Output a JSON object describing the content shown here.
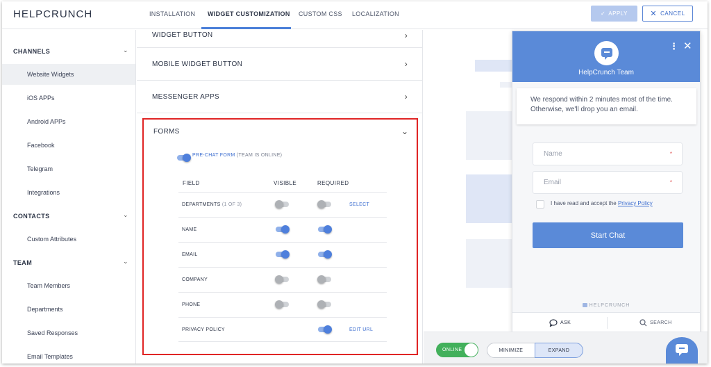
{
  "app": {
    "brand": "HELPCRUNCH"
  },
  "nav": {
    "tabs": [
      {
        "label": "INSTALLATION"
      },
      {
        "label": "WIDGET CUSTOMIZATION"
      },
      {
        "label": "CUSTOM CSS"
      },
      {
        "label": "LOCALIZATION"
      }
    ],
    "active_tab": "WIDGET CUSTOMIZATION",
    "apply_label": "APPLY",
    "cancel_label": "CANCEL"
  },
  "sidebar": {
    "sections": [
      {
        "title": "CHANNELS",
        "items": [
          "Website Widgets",
          "iOS APPs",
          "Android APPs",
          "Facebook",
          "Telegram",
          "Integrations"
        ]
      },
      {
        "title": "CONTACTS",
        "items": [
          "Custom Attributes"
        ]
      },
      {
        "title": "TEAM",
        "items": [
          "Team Members",
          "Departments",
          "Saved Responses",
          "Email Templates"
        ]
      }
    ],
    "active_item": "Website Widgets"
  },
  "settings": {
    "accordion": [
      "WIDGET BUTTON",
      "MOBILE WIDGET BUTTON",
      "MESSENGER APPS"
    ],
    "forms": {
      "title": "FORMS",
      "pre_chat_label": "PRE-CHAT FORM",
      "pre_chat_note": "(TEAM IS ONLINE)",
      "pre_chat_enabled": true,
      "columns": [
        "FIELD",
        "VISIBLE",
        "REQUIRED"
      ],
      "rows": [
        {
          "field": "DEPARTMENTS",
          "count": "(1 OF 3)",
          "visible": false,
          "required": false,
          "link": "SELECT"
        },
        {
          "field": "NAME",
          "count": "",
          "visible": true,
          "required": true,
          "link": ""
        },
        {
          "field": "EMAIL",
          "count": "",
          "visible": true,
          "required": true,
          "link": ""
        },
        {
          "field": "COMPANY",
          "count": "",
          "visible": false,
          "required": false,
          "link": ""
        },
        {
          "field": "PHONE",
          "count": "",
          "visible": false,
          "required": false,
          "link": ""
        },
        {
          "field": "PRIVACY POLICY",
          "count": "",
          "visible": null,
          "required": true,
          "link": "EDIT URL"
        }
      ]
    }
  },
  "preview": {
    "team_name": "HelpCrunch Team",
    "message": "We respond within 2 minutes most of the time. Otherwise, we'll drop you an email.",
    "name_placeholder": "Name",
    "email_placeholder": "Email",
    "required_mark": "*",
    "accept_text": "I have read and accept the",
    "privacy_link": "Privacy Policy",
    "start_button": "Start Chat",
    "powered_by": "HELPCRUNCH",
    "footer_tabs": [
      "ASK",
      "SEARCH"
    ],
    "status_label": "ONLINE",
    "minimize_label": "MINIMIZE",
    "expand_label": "EXPAND"
  },
  "colors": {
    "accent": "#5a8ad8",
    "online": "#42b05b",
    "highlight_border": "#e02424"
  }
}
